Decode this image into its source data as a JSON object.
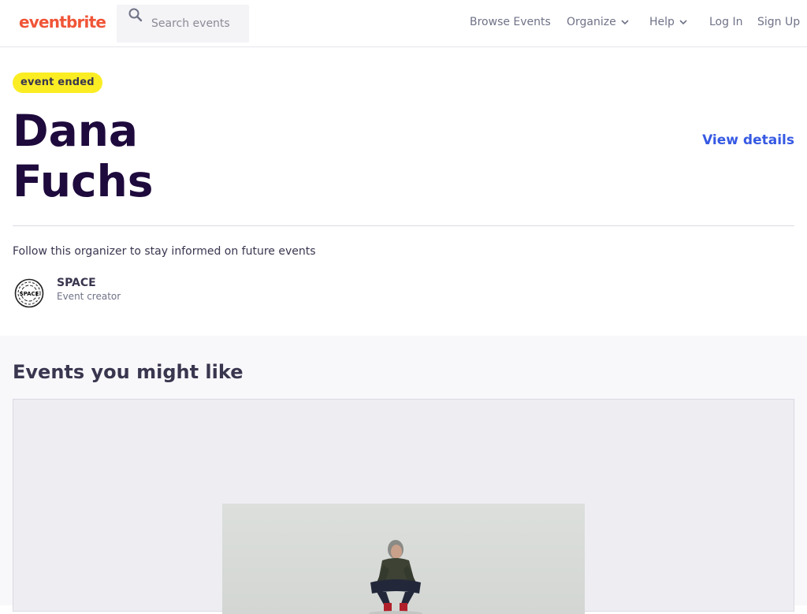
{
  "header": {
    "logo": "eventbrite",
    "search_placeholder": "Search events",
    "nav": {
      "browse": "Browse Events",
      "organize": "Organize",
      "help": "Help",
      "login": "Log In",
      "signup": "Sign Up"
    }
  },
  "event": {
    "status_badge": "event ended",
    "title_line1": "Dana",
    "title_line2": "Fuchs",
    "view_details": "View details"
  },
  "organizer": {
    "follow_text": "Follow this organizer to stay informed on future events",
    "name": "SPACE",
    "role": "Event creator",
    "avatar_text": "SPACE"
  },
  "recommendations": {
    "title": "Events you might like"
  },
  "colors": {
    "brand": "#f05537",
    "badge": "#fbed23",
    "link": "#3659e3",
    "title": "#1e0a3c"
  }
}
